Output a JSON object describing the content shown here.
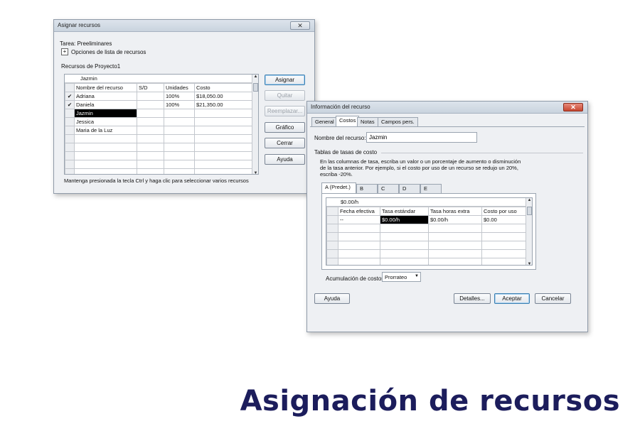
{
  "assign": {
    "title": "Asignar recursos",
    "close": "✕",
    "task_label": "Tarea: Preeliminares",
    "options_toggle": "+",
    "options_label": "Opciones de lista de recursos",
    "group_label": "Recursos de Proyecto1",
    "edit_value": "Jazmin",
    "headers": [
      "Nombre del recurso",
      "S/D",
      "Unidades",
      "Costo"
    ],
    "rows": [
      {
        "check": "✔",
        "name": "Adriana",
        "sd": "",
        "units": "100%",
        "cost": "$18,050.00"
      },
      {
        "check": "✔",
        "name": "Daniela",
        "sd": "",
        "units": "100%",
        "cost": "$21,350.00"
      },
      {
        "check": "",
        "name": "Jazmin",
        "sd": "",
        "units": "",
        "cost": ""
      },
      {
        "check": "",
        "name": "Jessica",
        "sd": "",
        "units": "",
        "cost": ""
      },
      {
        "check": "",
        "name": "Maria de la Luz",
        "sd": "",
        "units": "",
        "cost": ""
      }
    ],
    "buttons": {
      "assign": "Asignar",
      "remove": "Quitar",
      "replace": "Reemplazar...",
      "graph": "Gráfico",
      "close": "Cerrar",
      "help": "Ayuda"
    },
    "hint": "Mantenga presionada la tecla Ctrl y haga clic para seleccionar varios recursos"
  },
  "info": {
    "title": "Información del recurso",
    "close": "✕",
    "tabs": [
      "General",
      "Costos",
      "Notas",
      "Campos pers."
    ],
    "name_label": "Nombre del recurso:",
    "name_value": "Jazmin",
    "rates_group": "Tablas de tasas de costo",
    "instructions": "En las columnas de tasa, escriba un valor o un porcentaje de aumento o disminución de la tasa anterior. Por ejemplo, si el costo por uso de un recurso se redujo un 20%, escriba -20%.",
    "rate_tabs": [
      "A (Predet.)",
      "B",
      "C",
      "D",
      "E"
    ],
    "edit_value": "$0.00/h",
    "headers": [
      "Fecha efectiva",
      "Tasa estándar",
      "Tasa horas extra",
      "Costo por uso"
    ],
    "rows": [
      {
        "date": "--",
        "std": "$0.00/h",
        "ot": "$0.00/h",
        "per_use": "$0.00"
      }
    ],
    "accrual_label": "Acumulación de costos:",
    "accrual_value": "Prorrateo",
    "buttons": {
      "help": "Ayuda",
      "details": "Detalles...",
      "ok": "Aceptar",
      "cancel": "Cancelar"
    }
  },
  "caption": "Asignación de recursos"
}
